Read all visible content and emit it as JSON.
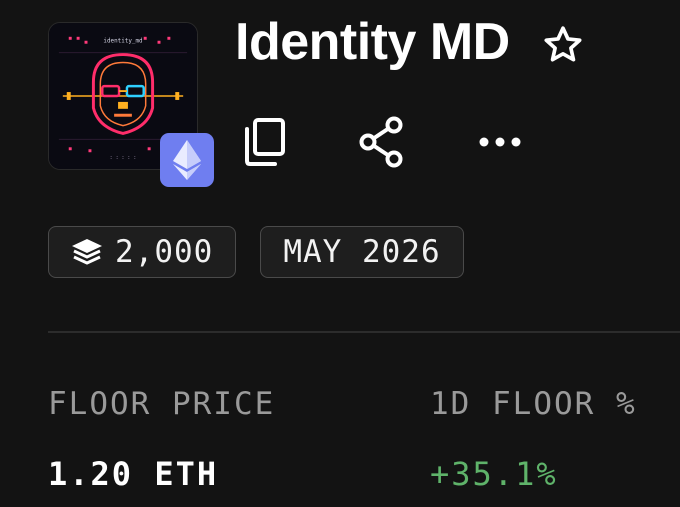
{
  "collection": {
    "name": "Identity MD",
    "chain_icon": "ethereum-icon",
    "chain_badge_color": "#6f7ef0"
  },
  "actions": [
    {
      "name": "copy",
      "icon": "copy-icon"
    },
    {
      "name": "share",
      "icon": "share-icon"
    },
    {
      "name": "more",
      "icon": "more-horizontal-icon"
    }
  ],
  "favorite_icon": "star-outline-icon",
  "chips": {
    "supply": {
      "icon": "layers-icon",
      "value": "2,000"
    },
    "date": {
      "value": "MAY 2026"
    }
  },
  "stats": {
    "floor_price": {
      "label": "FLOOR PRICE",
      "value": "1.20 ETH"
    },
    "floor_change_1d": {
      "label": "1D FLOOR %",
      "value": "+35.1%",
      "color": "#5fb36a"
    }
  },
  "colors": {
    "background": "#131313",
    "chip_border": "#4a4a4a",
    "muted_text": "#9a9a9a",
    "positive": "#5fb36a"
  }
}
